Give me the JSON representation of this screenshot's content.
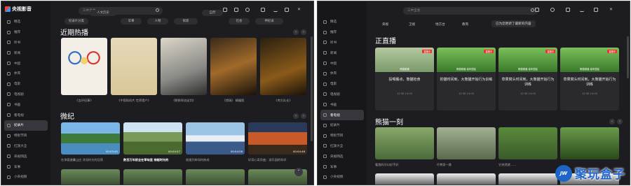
{
  "colors": {
    "bg": "#1d1d21",
    "sidebar": "#17171a",
    "accent": "#e33333",
    "watermark": "#1f63cc"
  },
  "app": {
    "name": "央视影音"
  },
  "sidebar": {
    "items": [
      {
        "label": "精选",
        "icon": "home-icon"
      },
      {
        "label": "推荐",
        "icon": "recommend-icon"
      },
      {
        "label": "听书",
        "icon": "book-icon"
      },
      {
        "label": "新闻",
        "icon": "news-icon"
      },
      {
        "label": "中超",
        "icon": "csl-icon"
      },
      {
        "label": "体育",
        "icon": "sports-icon"
      },
      {
        "label": "电影",
        "icon": "movie-icon"
      },
      {
        "label": "电视剧",
        "icon": "tv-series-icon"
      },
      {
        "label": "书画",
        "icon": "painting-icon"
      },
      {
        "label": "看电视",
        "icon": "tv-icon"
      },
      {
        "label": "纪录片",
        "icon": "documentary-icon"
      },
      {
        "label": "特别节目",
        "icon": "special-icon"
      },
      {
        "label": "红旗大全",
        "icon": "flag-icon"
      },
      {
        "label": "央视网选",
        "icon": "cctv-icon"
      },
      {
        "label": "军事",
        "icon": "military-icon"
      },
      {
        "label": "小央视频",
        "icon": "video-icon"
      }
    ]
  },
  "w1": {
    "search_placeholder": "三中全会",
    "chips": [
      "纪录片分类",
      "人文历史",
      "军事",
      "人物",
      "探索",
      "自然",
      "社会",
      "神纪录"
    ],
    "section1": "近期热播",
    "hot": [
      {
        "title": "《五环纪事》"
      },
      {
        "title": "《中国陆机片 世界遗产》"
      },
      {
        "title": "《朝鲜停战谈判》"
      },
      {
        "title": "《猎瑞》 精编版"
      },
      {
        "title": "《考古队长》"
      }
    ],
    "section2": "微纪",
    "micro": [
      {
        "title": "在承德避暑山庄 沐浴时光的回荡",
        "dur": "00:03:45"
      },
      {
        "title": "数百万年前全在草甸里 穿越时光的",
        "dur": "00:04:57"
      },
      {
        "title": "极速列车如何炼成",
        "dur": "00:04:58"
      },
      {
        "title": "好奇心奇异曲：游乐园的科学",
        "dur": "00:04:46"
      }
    ]
  },
  "w2": {
    "search_placeholder": "三中全会",
    "tabs": [
      "央视",
      "卫视",
      "地方台",
      "教育"
    ],
    "toast": "已为您更新了最新的内容",
    "section1": "正直播",
    "live_badge": "直播中",
    "live": [
      {
        "channel": "熊猫频道",
        "title": "投喂餐点，熊猫抢食",
        "time": "12:30-14:00"
      },
      {
        "channel": "熊猫频道-幼年园区",
        "title": "豹猫时间到，大熊猫开始行为训练",
        "time": "12:30-14:00"
      },
      {
        "channel": "熊猫频道-幼年园区",
        "title": "草果窝头时间到，大熊猫开始行为训练",
        "time": "12:30-14:00"
      },
      {
        "channel": "熊猫频道-幼年园区",
        "title": "草果窝头时间到，大熊猫开始行为训练",
        "time": "12:30-14:00"
      }
    ],
    "section2": "熊猫一刻",
    "panda": [
      {
        "title": "看我的牙口好不好"
      },
      {
        "title": "吓熊家一跳"
      },
      {
        "title": "它突然就……"
      },
      {
        "title": ""
      }
    ],
    "watermark": "聚玩盒子",
    "watermark_badge": "JW"
  }
}
